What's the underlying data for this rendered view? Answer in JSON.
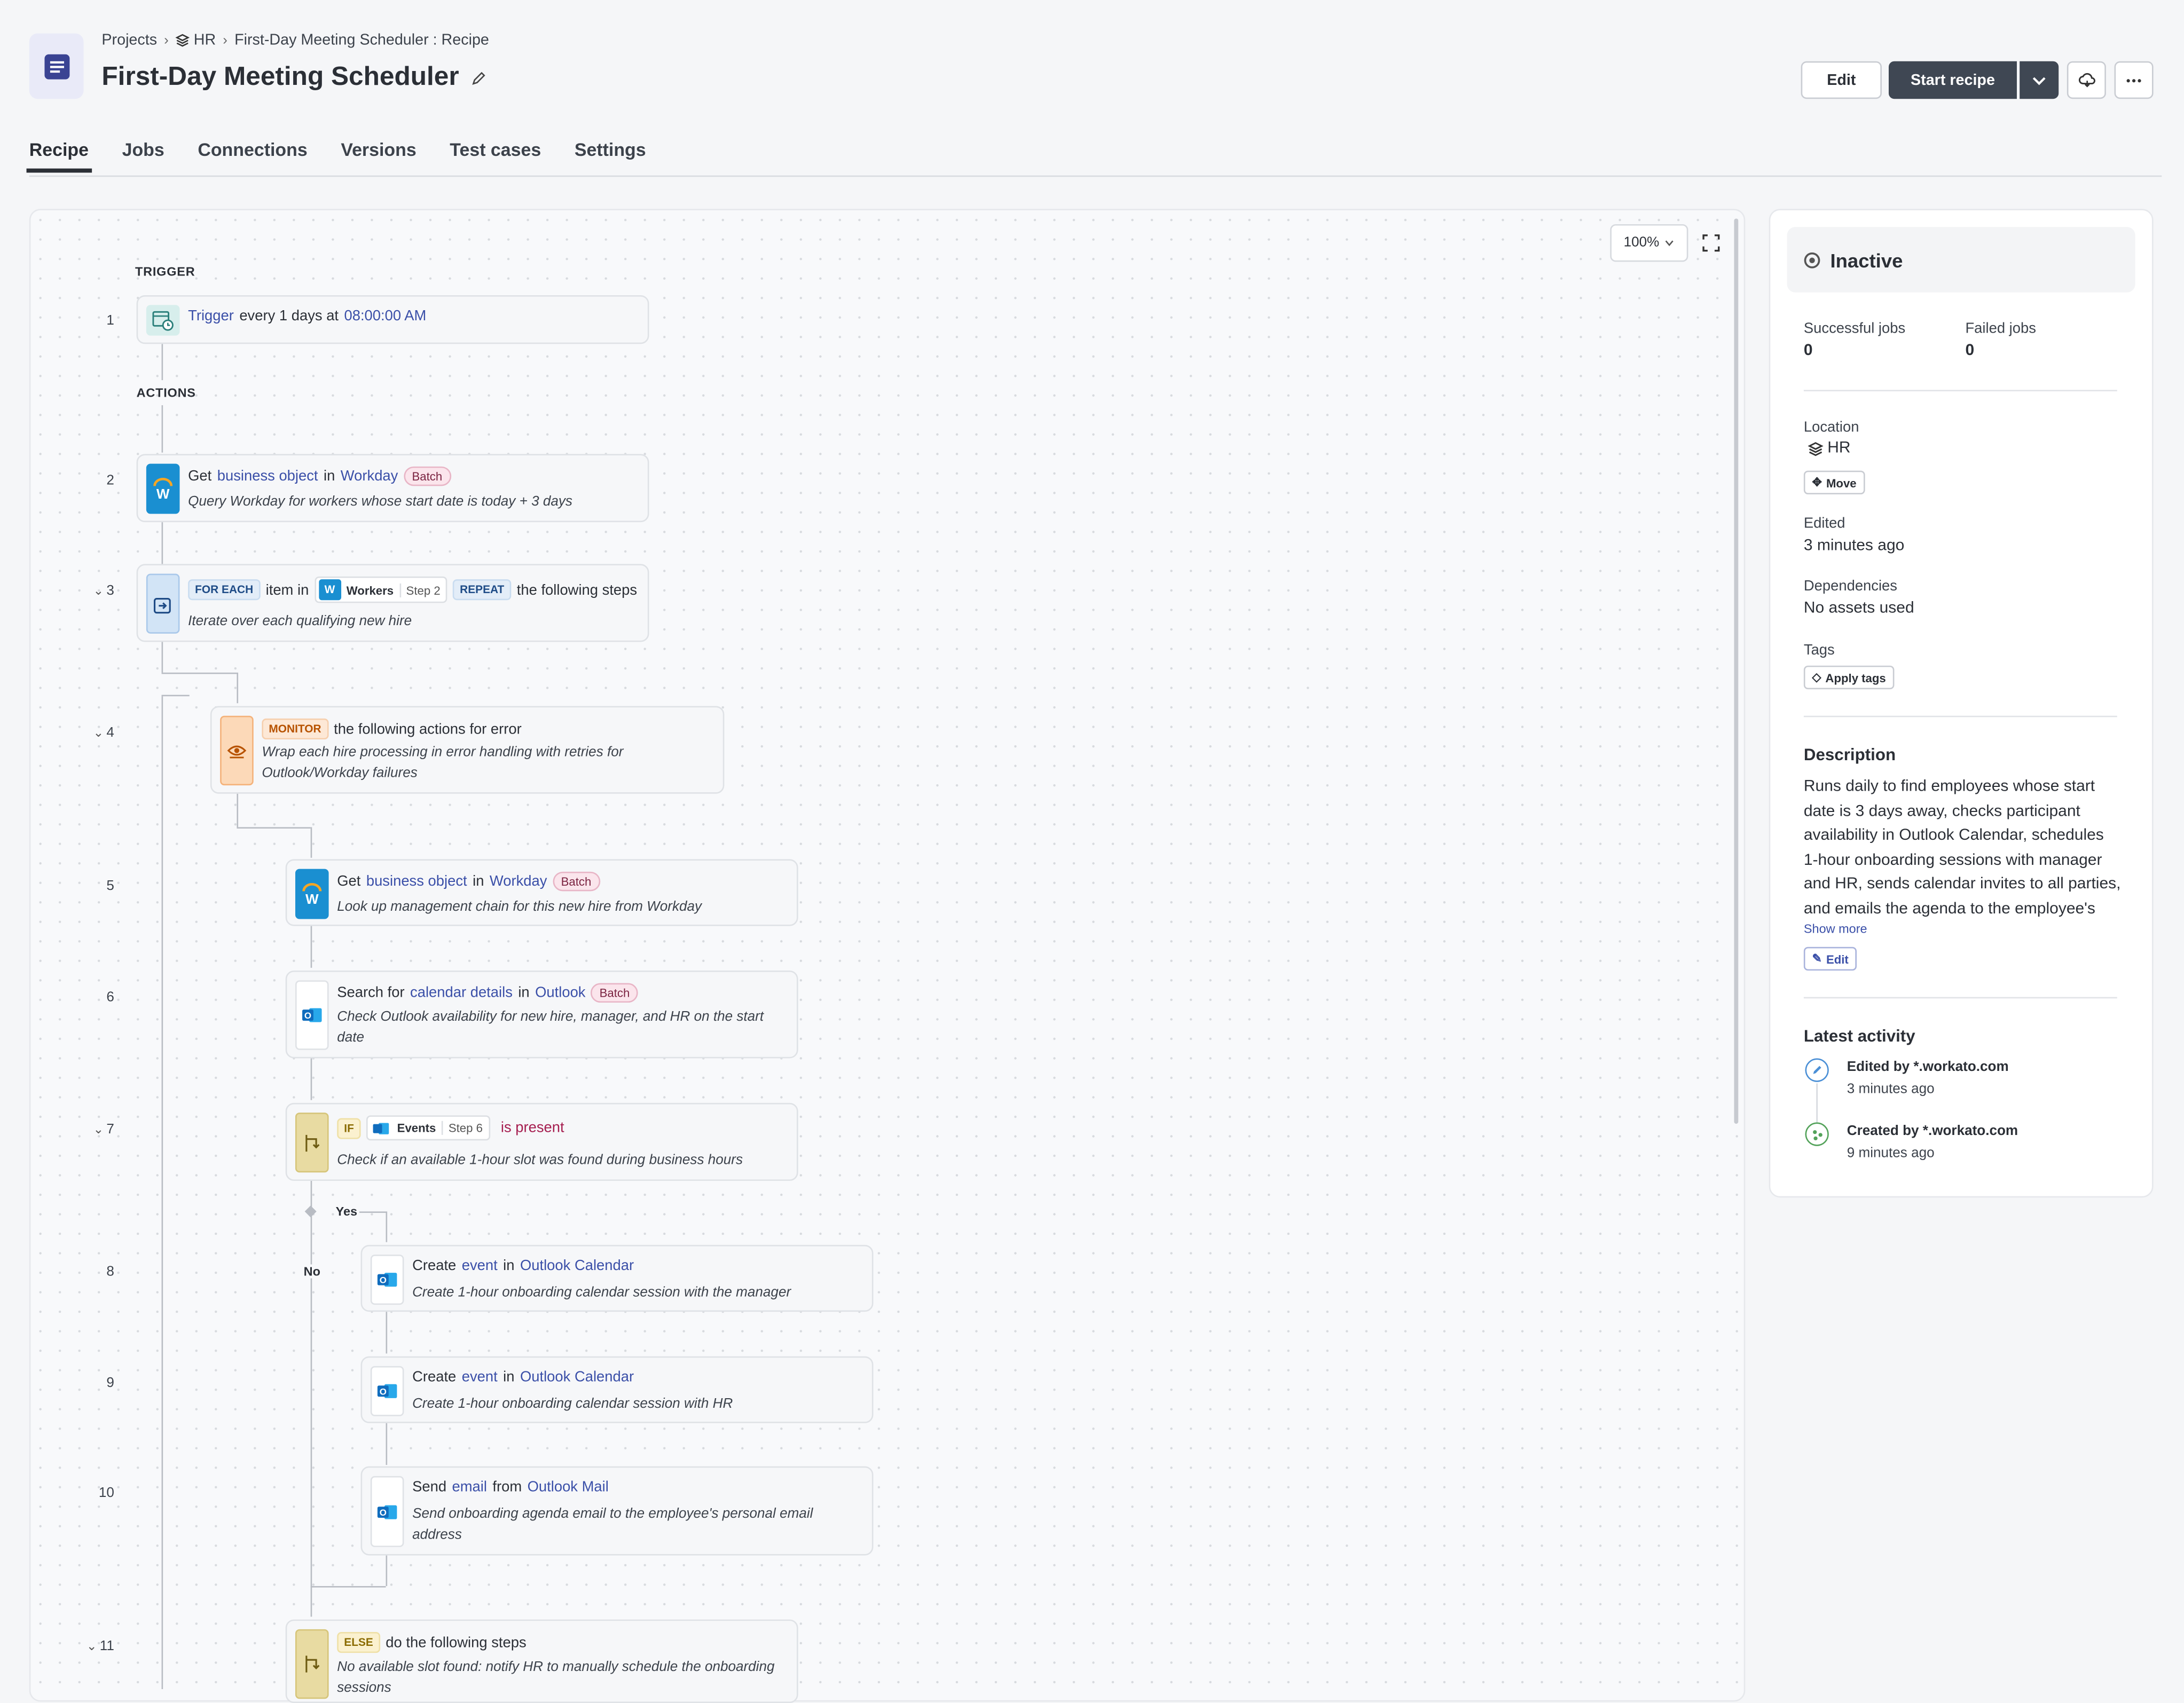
{
  "breadcrumb": {
    "projects": "Projects",
    "folder": "HR",
    "current": "First-Day Meeting Scheduler : Recipe"
  },
  "header": {
    "title": "First-Day Meeting Scheduler",
    "edit_label": "Edit",
    "start_label": "Start recipe"
  },
  "tabs": [
    "Recipe",
    "Jobs",
    "Connections",
    "Versions",
    "Test cases",
    "Settings"
  ],
  "canvas": {
    "zoom": "100%",
    "trigger_section": "TRIGGER",
    "actions_section": "ACTIONS",
    "yes_label": "Yes",
    "no_label": "No"
  },
  "steps": {
    "s1": {
      "num": "1",
      "trigger": "Trigger",
      "mid": "every 1 days at",
      "time": "08:00:00 AM"
    },
    "s2": {
      "num": "2",
      "verb": "Get",
      "object": "business object",
      "in": "in",
      "app": "Workday",
      "badge": "Batch",
      "desc": "Query Workday for workers whose start date is today + 3 days"
    },
    "s3": {
      "num": "3",
      "kw": "FOR EACH",
      "mid": "item in",
      "pill": "Workers",
      "pill_step": "Step 2",
      "kw2": "REPEAT",
      "tail": "the following steps",
      "desc": "Iterate over each qualifying new hire"
    },
    "s4": {
      "num": "4",
      "kw": "MONITOR",
      "tail": "the following actions for error",
      "desc": "Wrap each hire processing in error handling with retries for Outlook/Workday failures"
    },
    "s5": {
      "num": "5",
      "verb": "Get",
      "object": "business object",
      "in": "in",
      "app": "Workday",
      "badge": "Batch",
      "desc": "Look up management chain for this new hire from Workday"
    },
    "s6": {
      "num": "6",
      "verb": "Search for",
      "object": "calendar details",
      "in": "in",
      "app": "Outlook",
      "badge": "Batch",
      "desc": "Check Outlook availability for new hire, manager, and HR on the start date"
    },
    "s7": {
      "num": "7",
      "kw": "IF",
      "pill": "Events",
      "pill_step": "Step 6",
      "cond": "is present",
      "desc": "Check if an available 1-hour slot was found during business hours"
    },
    "s8": {
      "num": "8",
      "verb": "Create",
      "object": "event",
      "in": "in",
      "app": "Outlook Calendar",
      "desc": "Create 1-hour onboarding calendar session with the manager"
    },
    "s9": {
      "num": "9",
      "verb": "Create",
      "object": "event",
      "in": "in",
      "app": "Outlook Calendar",
      "desc": "Create 1-hour onboarding calendar session with HR"
    },
    "s10": {
      "num": "10",
      "verb": "Send",
      "object": "email",
      "in": "from",
      "app": "Outlook Mail",
      "desc": "Send onboarding agenda email to the employee's personal email address"
    },
    "s11": {
      "num": "11",
      "kw": "ELSE",
      "tail": "do the following steps",
      "desc": "No available slot found: notify HR to manually schedule the onboarding sessions"
    }
  },
  "panel": {
    "status": "Inactive",
    "successful_label": "Successful jobs",
    "successful_value": "0",
    "failed_label": "Failed jobs",
    "failed_value": "0",
    "location_label": "Location",
    "location_value": "HR",
    "move_label": "Move",
    "edited_label": "Edited",
    "edited_value": "3 minutes ago",
    "deps_label": "Dependencies",
    "deps_value": "No assets used",
    "tags_label": "Tags",
    "apply_tags_label": "Apply tags",
    "description_heading": "Description",
    "description": "Runs daily to find employees whose start date is 3 days away, checks participant availability in Outlook Calendar, schedules 1-hour onboarding sessions with manager and HR, sends calendar invites to all parties, and emails the agenda to the employee's personal email.",
    "show_more": "Show more",
    "desc_edit_label": "Edit",
    "activity_heading": "Latest activity",
    "activity": [
      {
        "title": "Edited by *.workato.com",
        "time": "3 minutes ago"
      },
      {
        "title": "Created by *.workato.com",
        "time": "9 minutes ago"
      }
    ]
  },
  "colors": {
    "accent_link": "#3a4fa8",
    "dark_button": "#3f4753",
    "workday_blue": "#1a8fd1",
    "outlook_blue": "#0f6cbd"
  }
}
